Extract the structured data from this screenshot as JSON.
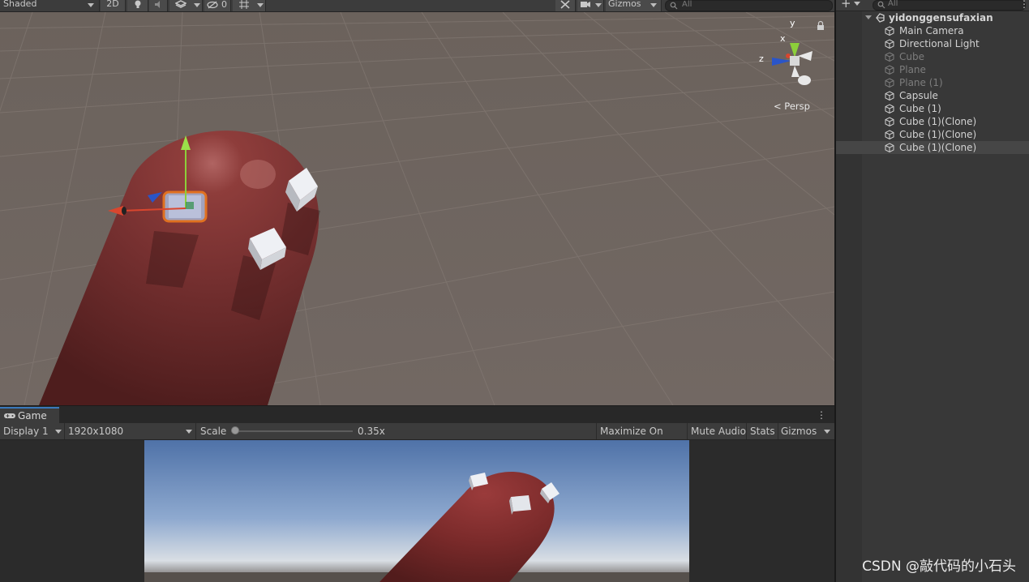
{
  "scene_toolbar": {
    "shading_mode": "Shaded",
    "mode_2d": "2D",
    "hidden_count": "0",
    "gizmos_label": "Gizmos",
    "search_placeholder": "All"
  },
  "scene_view": {
    "persp_label": "Persp",
    "axis_y": "y",
    "axis_x": "x",
    "axis_z": "z"
  },
  "game_panel": {
    "tab_label": "Game",
    "display": "Display 1",
    "resolution": "1920x1080",
    "scale_label": "Scale",
    "scale_value": "0.35x",
    "scale_fraction": 0.0,
    "maximize_on_play": "Maximize On Play",
    "mute_audio": "Mute Audio",
    "stats": "Stats",
    "gizmos": "Gizmos"
  },
  "hierarchy": {
    "search_placeholder": "All",
    "scene_name": "yidonggensufaxian",
    "items": [
      {
        "label": "Main Camera",
        "active": true
      },
      {
        "label": "Directional Light",
        "active": true
      },
      {
        "label": "Cube",
        "active": false
      },
      {
        "label": "Plane",
        "active": false
      },
      {
        "label": "Plane (1)",
        "active": false
      },
      {
        "label": "Capsule",
        "active": true
      },
      {
        "label": "Cube (1)",
        "active": true
      },
      {
        "label": "Cube (1)(Clone)",
        "active": true
      },
      {
        "label": "Cube (1)(Clone)",
        "active": true
      },
      {
        "label": "Cube (1)(Clone)",
        "active": true,
        "selected": true
      }
    ]
  },
  "watermark": "CSDN @敲代码的小石头",
  "colors": {
    "capsule": "#7a2a2a",
    "ground": "#6e645e",
    "selection": "#f07b1d",
    "tab_accent": "#3a79bb"
  }
}
